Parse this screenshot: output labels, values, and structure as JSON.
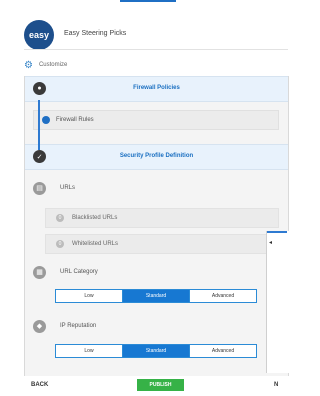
{
  "app": {
    "logo_text": "easy",
    "title": "Easy Steering Picks"
  },
  "customize": {
    "icon": "gear-icon",
    "label": "Customize"
  },
  "firewall_policies": {
    "title": "Firewall Policies",
    "rules_row": {
      "label": "Firewall Rules"
    }
  },
  "security_profile": {
    "title": "Security Profile Definition",
    "urls": {
      "label": "URLs",
      "rows": [
        {
          "badge": "0",
          "label": "Blacklisted URLs"
        },
        {
          "badge": "0",
          "label": "Whitelisted URLs"
        }
      ]
    },
    "url_category": {
      "label": "URL Category",
      "options": [
        "Low",
        "Standard",
        "Advanced"
      ],
      "selected": "Standard"
    },
    "ip_reputation": {
      "label": "IP Reputation",
      "options": [
        "Low",
        "Standard",
        "Advanced"
      ],
      "selected": "Standard"
    }
  },
  "footer": {
    "back_label": "BACK",
    "publish_label": "PUBLISH",
    "next_label": "N"
  },
  "colors": {
    "accent": "#1778d2",
    "publish": "#36b247",
    "section_bg": "#e8f2fc"
  }
}
